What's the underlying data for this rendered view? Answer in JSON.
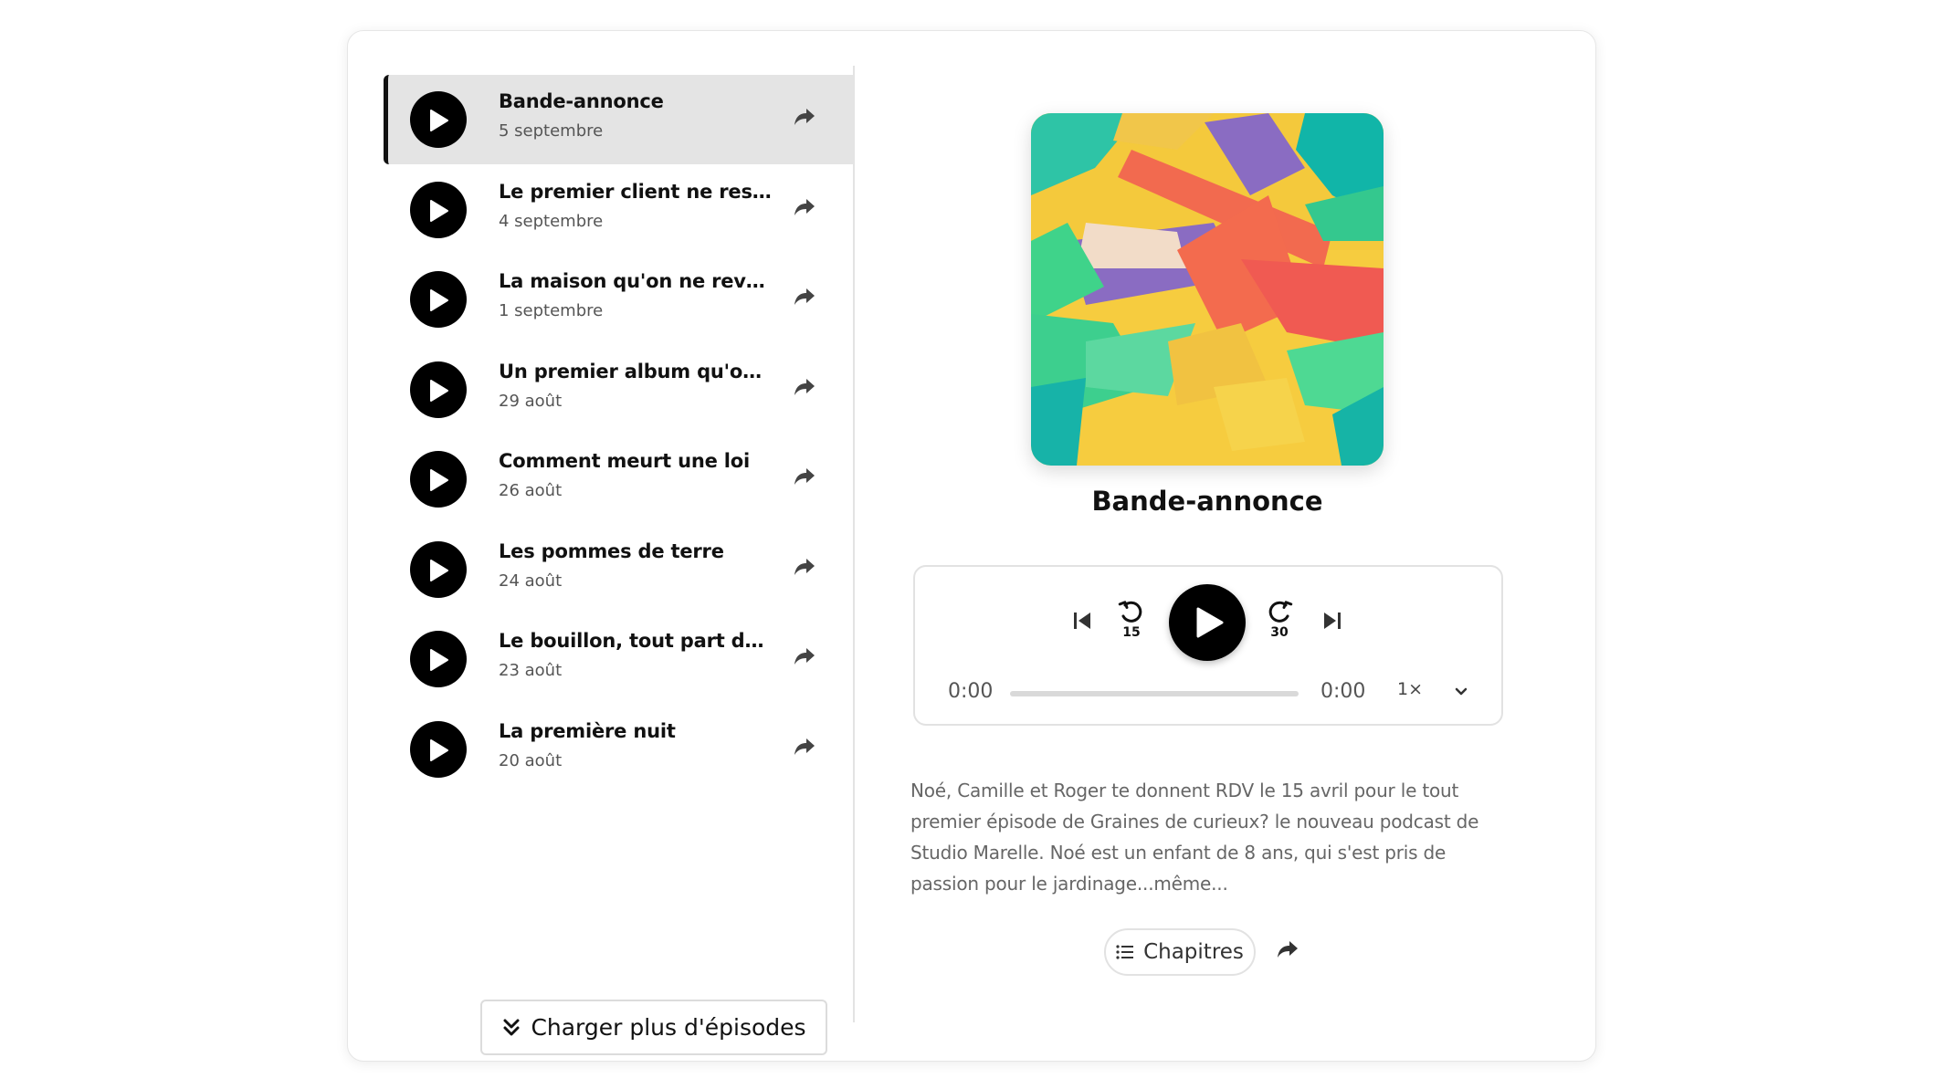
{
  "episodes": [
    {
      "title": "Bande-annonce",
      "date": "5 septembre"
    },
    {
      "title": "Le premier client ne ressemble pas à ce qu'on croit",
      "date": "4 septembre"
    },
    {
      "title": "La maison qu'on ne revend pas",
      "date": "1 septembre"
    },
    {
      "title": "Un premier album qu'on n'attendait plus",
      "date": "29 août"
    },
    {
      "title": "Comment meurt une loi",
      "date": "26 août"
    },
    {
      "title": "Les pommes de terre",
      "date": "24 août"
    },
    {
      "title": "Le bouillon, tout part de là",
      "date": "23 août"
    },
    {
      "title": "La première nuit",
      "date": "20 août"
    }
  ],
  "load_more_label": "Charger plus d'épisodes",
  "now_playing": {
    "title": "Bande-annonce",
    "description": "Noé, Camille et Roger te donnent RDV le 15 avril pour le tout premier épisode de Graines de curieux? le nouveau podcast de Studio Marelle.  Noé est un enfant de 8 ans, qui s'est pris de passion pour le jardinage...même..."
  },
  "player": {
    "rewind_seconds": "15",
    "forward_seconds": "30",
    "current_time": "0:00",
    "duration": "0:00",
    "speed": "1×",
    "progress": 0
  },
  "chapters_label": "Chapitres",
  "icons": {
    "play": "play-icon",
    "share": "share-icon",
    "skip_back": "skip-previous-icon",
    "skip_forward": "skip-next-icon",
    "rewind": "rewind-15-icon",
    "forward": "forward-30-icon",
    "chevron": "chevron-down-icon",
    "list": "list-icon",
    "load_more": "double-chevron-down-icon"
  },
  "colors": {
    "accent": "#000000",
    "active_row": "#e4e4e4",
    "muted_text": "#666666"
  }
}
